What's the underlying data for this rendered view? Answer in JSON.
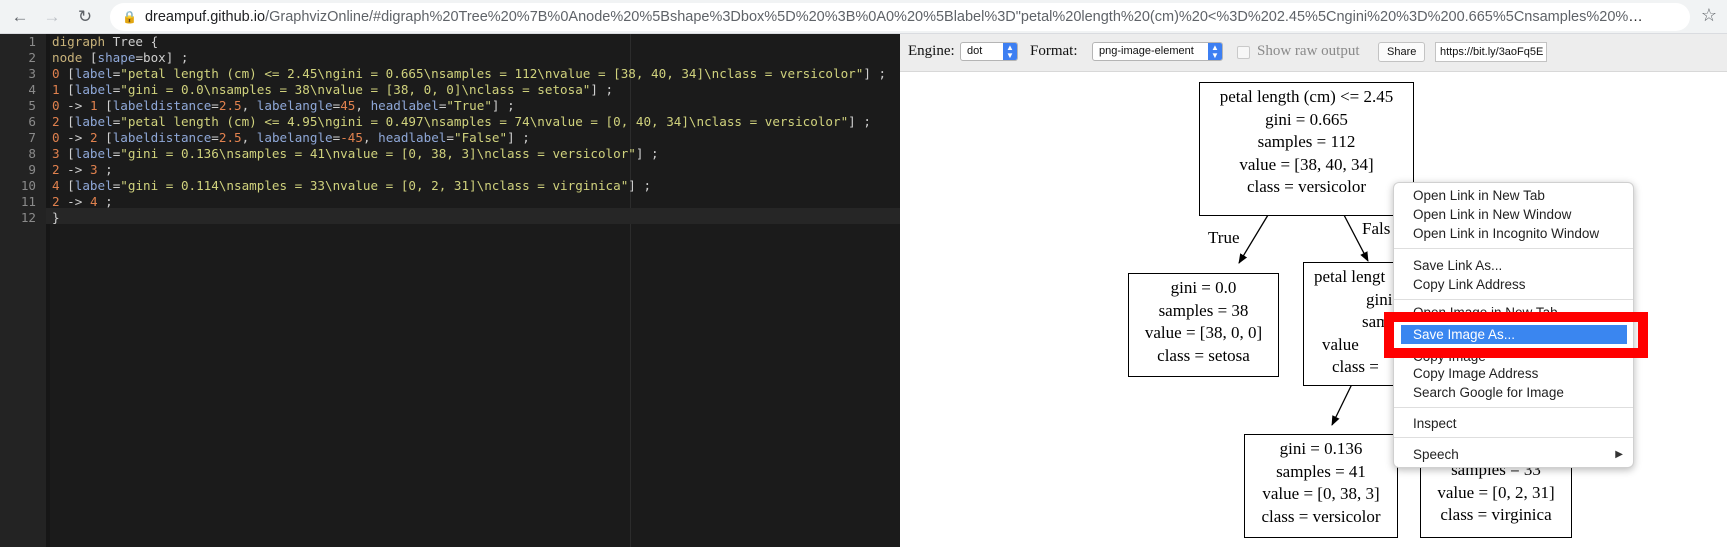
{
  "browser": {
    "url_host": "dreampuf.github.io",
    "url_path": "/GraphvizOnline/#digraph%20Tree%20%7B%0Anode%20%5Bshape%3Dbox%5D%20%3B%0A0%20%5Blabel%3D\"petal%20length%20(cm)%20<%3D%202.45%5Cngini%20%3D%200.665%5Cnsamples%20%3D%20112%5..."
  },
  "editor": {
    "line_numbers": [
      "1",
      "2",
      "3",
      "4",
      "5",
      "6",
      "7",
      "8",
      "9",
      "10",
      "11",
      "12"
    ],
    "lines": [
      [
        {
          "t": "digraph",
          "c": "k"
        },
        {
          "t": " Tree {",
          "c": "pun"
        }
      ],
      [
        {
          "t": "node",
          "c": "k"
        },
        {
          "t": " [",
          "c": "pun"
        },
        {
          "t": "shape",
          "c": "attr"
        },
        {
          "t": "=box] ;",
          "c": "pun"
        }
      ],
      [
        {
          "t": "0",
          "c": "num"
        },
        {
          "t": " [",
          "c": "pun"
        },
        {
          "t": "label",
          "c": "attr"
        },
        {
          "t": "=",
          "c": "pun"
        },
        {
          "t": "\"petal length (cm) <= 2.45\\ngini = 0.665\\nsamples = 112\\nvalue = [38, 40, 34]\\nclass = versicolor\"",
          "c": "str"
        },
        {
          "t": "] ;",
          "c": "pun"
        }
      ],
      [
        {
          "t": "1",
          "c": "num"
        },
        {
          "t": " [",
          "c": "pun"
        },
        {
          "t": "label",
          "c": "attr"
        },
        {
          "t": "=",
          "c": "pun"
        },
        {
          "t": "\"gini = 0.0\\nsamples = 38\\nvalue = [38, 0, 0]\\nclass = setosa\"",
          "c": "str"
        },
        {
          "t": "] ;",
          "c": "pun"
        }
      ],
      [
        {
          "t": "0",
          "c": "num"
        },
        {
          "t": " -> ",
          "c": "pun"
        },
        {
          "t": "1",
          "c": "num"
        },
        {
          "t": " [",
          "c": "pun"
        },
        {
          "t": "labeldistance",
          "c": "attr"
        },
        {
          "t": "=",
          "c": "pun"
        },
        {
          "t": "2.5",
          "c": "num"
        },
        {
          "t": ", ",
          "c": "pun"
        },
        {
          "t": "labelangle",
          "c": "attr"
        },
        {
          "t": "=",
          "c": "pun"
        },
        {
          "t": "45",
          "c": "num"
        },
        {
          "t": ", ",
          "c": "pun"
        },
        {
          "t": "headlabel",
          "c": "attr"
        },
        {
          "t": "=",
          "c": "pun"
        },
        {
          "t": "\"True\"",
          "c": "str"
        },
        {
          "t": "] ;",
          "c": "pun"
        }
      ],
      [
        {
          "t": "2",
          "c": "num"
        },
        {
          "t": " [",
          "c": "pun"
        },
        {
          "t": "label",
          "c": "attr"
        },
        {
          "t": "=",
          "c": "pun"
        },
        {
          "t": "\"petal length (cm) <= 4.95\\ngini = 0.497\\nsamples = 74\\nvalue = [0, 40, 34]\\nclass = versicolor\"",
          "c": "str"
        },
        {
          "t": "] ;",
          "c": "pun"
        }
      ],
      [
        {
          "t": "0",
          "c": "num"
        },
        {
          "t": " -> ",
          "c": "pun"
        },
        {
          "t": "2",
          "c": "num"
        },
        {
          "t": " [",
          "c": "pun"
        },
        {
          "t": "labeldistance",
          "c": "attr"
        },
        {
          "t": "=",
          "c": "pun"
        },
        {
          "t": "2.5",
          "c": "num"
        },
        {
          "t": ", ",
          "c": "pun"
        },
        {
          "t": "labelangle",
          "c": "attr"
        },
        {
          "t": "=",
          "c": "pun"
        },
        {
          "t": "-45",
          "c": "num"
        },
        {
          "t": ", ",
          "c": "pun"
        },
        {
          "t": "headlabel",
          "c": "attr"
        },
        {
          "t": "=",
          "c": "pun"
        },
        {
          "t": "\"False\"",
          "c": "str"
        },
        {
          "t": "] ;",
          "c": "pun"
        }
      ],
      [
        {
          "t": "3",
          "c": "num"
        },
        {
          "t": " [",
          "c": "pun"
        },
        {
          "t": "label",
          "c": "attr"
        },
        {
          "t": "=",
          "c": "pun"
        },
        {
          "t": "\"gini = 0.136\\nsamples = 41\\nvalue = [0, 38, 3]\\nclass = versicolor\"",
          "c": "str"
        },
        {
          "t": "] ;",
          "c": "pun"
        }
      ],
      [
        {
          "t": "2",
          "c": "num"
        },
        {
          "t": " -> ",
          "c": "pun"
        },
        {
          "t": "3",
          "c": "num"
        },
        {
          "t": " ;",
          "c": "pun"
        }
      ],
      [
        {
          "t": "4",
          "c": "num"
        },
        {
          "t": " [",
          "c": "pun"
        },
        {
          "t": "label",
          "c": "attr"
        },
        {
          "t": "=",
          "c": "pun"
        },
        {
          "t": "\"gini = 0.114\\nsamples = 33\\nvalue = [0, 2, 31]\\nclass = virginica\"",
          "c": "str"
        },
        {
          "t": "] ;",
          "c": "pun"
        }
      ],
      [
        {
          "t": "2",
          "c": "num"
        },
        {
          "t": " -> ",
          "c": "pun"
        },
        {
          "t": "4",
          "c": "num"
        },
        {
          "t": " ;",
          "c": "pun"
        }
      ],
      [
        {
          "t": "}",
          "c": "pun"
        }
      ]
    ]
  },
  "toolbar": {
    "engine_label": "Engine:",
    "engine_value": "dot",
    "format_label": "Format:",
    "format_value": "png-image-element",
    "raw_output_label": "Show raw output",
    "share_label": "Share",
    "share_url": "https://bit.ly/3aoFq5E"
  },
  "graph": {
    "nodes": [
      {
        "id": "0",
        "lines": [
          "petal length (cm) <= 2.45",
          "gini = 0.665",
          "samples = 112",
          "value = [38, 40, 34]",
          "class = versicolor"
        ]
      },
      {
        "id": "1",
        "lines": [
          "gini = 0.0",
          "samples = 38",
          "value = [38, 0, 0]",
          "class = setosa"
        ]
      },
      {
        "id": "2",
        "lines": [
          "petal lengt",
          "gini",
          "sam",
          "value",
          "class ="
        ]
      },
      {
        "id": "3",
        "lines": [
          "gini = 0.136",
          "samples = 41",
          "value = [0, 38, 3]",
          "class = versicolor"
        ]
      },
      {
        "id": "4",
        "lines": [
          "samples = 33",
          "value = [0, 2, 31]",
          "class = virginica"
        ]
      }
    ],
    "edge_labels": {
      "true_label": "True",
      "false_label": "Fals"
    }
  },
  "context_menu": {
    "items": [
      {
        "label": "Open Link in New Tab"
      },
      {
        "label": "Open Link in New Window"
      },
      {
        "label": "Open Link in Incognito Window"
      },
      {
        "label": "Save Link As..."
      },
      {
        "label": "Copy Link Address"
      },
      {
        "label": "Open Image in New Tab"
      },
      {
        "label": "Save Image As..."
      },
      {
        "label": "Copy Image"
      },
      {
        "label": "Copy Image Address"
      },
      {
        "label": "Search Google for Image"
      },
      {
        "label": "Inspect"
      },
      {
        "label": "Speech"
      }
    ],
    "selected": "Save Image As...",
    "highlight_color": "#ff0000",
    "selection_color": "#3a86f0"
  }
}
